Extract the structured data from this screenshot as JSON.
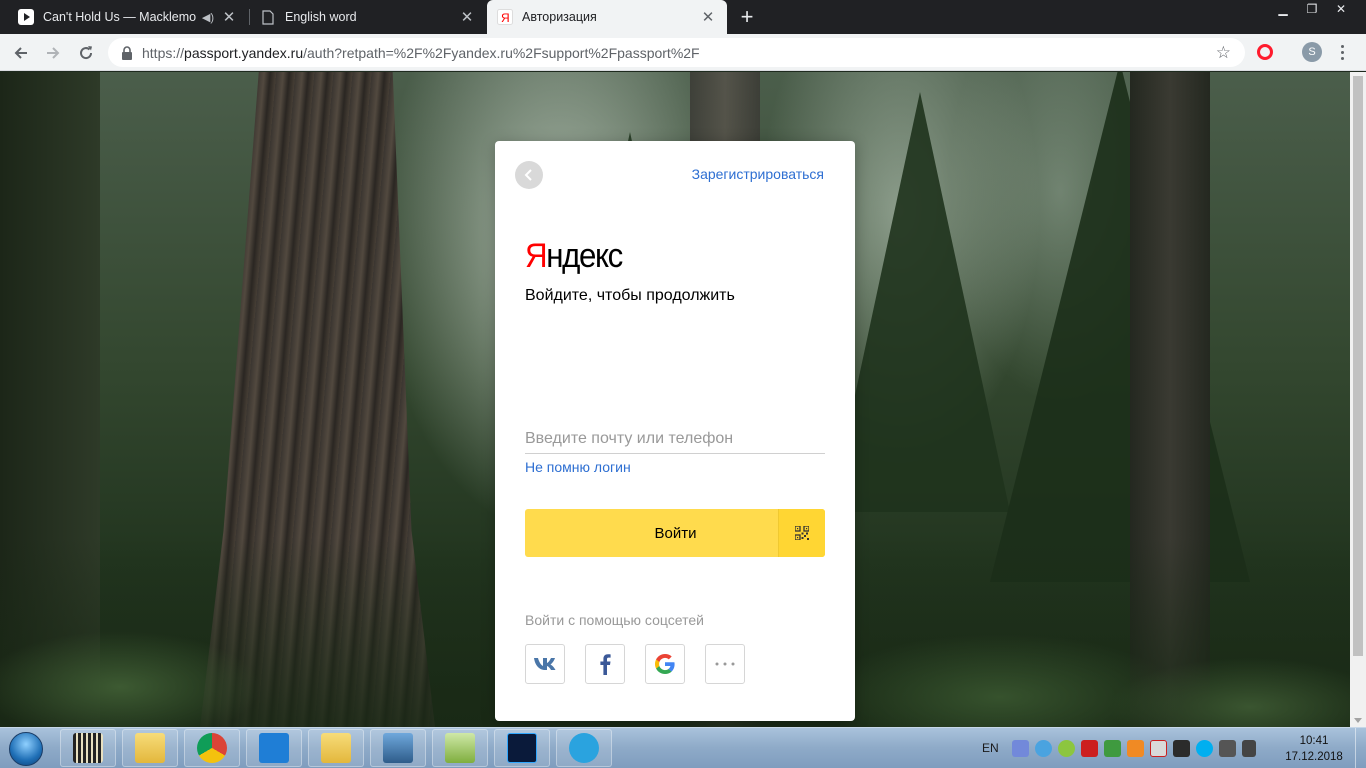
{
  "browser": {
    "tabs": [
      {
        "title": "Can't Hold Us — Macklemore",
        "state": "inactive",
        "audio": true
      },
      {
        "title": "English word",
        "state": "inactive",
        "audio": false
      },
      {
        "title": "Авторизация",
        "state": "active",
        "audio": false
      }
    ],
    "url": {
      "scheme": "https://",
      "host": "passport.yandex.ru",
      "path": "/auth?retpath=%2F%2Fyandex.ru%2Fsupport%2Fpassport%2F"
    },
    "profile_initial": "S"
  },
  "login": {
    "register_label": "Зарегистрироваться",
    "logo": {
      "first": "Я",
      "rest": "ндекс"
    },
    "subtitle": "Войдите, чтобы продолжить",
    "login_placeholder": "Введите почту или телефон",
    "forgot_label": "Не помню логин",
    "submit_label": "Войти",
    "social_title": "Войти с помощью соцсетей",
    "social_buttons": [
      "vk-icon",
      "facebook-icon",
      "google-icon",
      "more-icon"
    ]
  },
  "taskbar": {
    "language": "EN",
    "time": "10:41",
    "date": "17.12.2018"
  },
  "colors": {
    "accent_yellow": "#ffdb4d",
    "link_blue": "#2e6fd2",
    "yandex_red": "#ff0000",
    "chrome_dark": "#202124"
  }
}
